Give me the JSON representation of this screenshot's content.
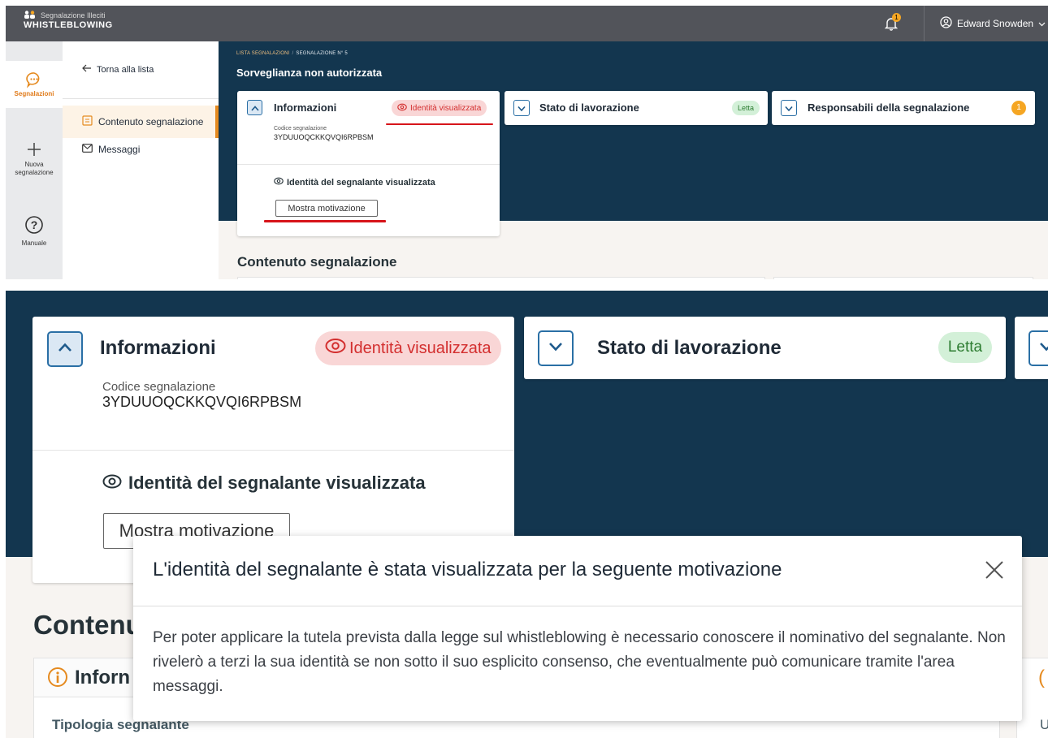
{
  "app": {
    "logo_line1": "Segnalazione Illeciti",
    "logo_line2": "WHISTLEBLOWING",
    "notifications_count": "1",
    "user_name": "Edward Snowden"
  },
  "rail": {
    "segnalazioni": "Segnalazioni",
    "nuova": "Nuova segnalazione",
    "manuale": "Manuale"
  },
  "nav": {
    "back": "Torna alla lista",
    "contenuto": "Contenuto segnalazione",
    "messaggi": "Messaggi"
  },
  "breadcrumb": {
    "list": "LISTA SEGNALAZIONI",
    "current": "SEGNALAZIONE N° 5"
  },
  "report": {
    "title": "Sorveglianza non autorizzata"
  },
  "info_card": {
    "title": "Informazioni",
    "identity_pill": "Identità visualizzata",
    "code_label": "Codice segnalazione",
    "code_value": "3YDUUOQCKKQVQI6RPBSM",
    "identity_status": "Identità del segnalante visualizzata",
    "show_reason_button": "Mostra motivazione"
  },
  "status_card": {
    "title": "Stato di lavorazione",
    "status": "Letta"
  },
  "responsabili_card": {
    "title": "Responsabili della segnalazione",
    "count": "1"
  },
  "section": {
    "contenuto": "Contenuto segnalazione",
    "contenuto_partial": "Contenu",
    "info_partial": "Inforn",
    "tipologia_partial": "Tipologia segnalante",
    "right_partial": "U"
  },
  "modal": {
    "title": "L'identità del segnalante è stata visualizzata per la seguente motivazione",
    "body": "Per poter applicare la tutela prevista dalla legge sul whistleblowing è necessario conoscere il nominativo del segnalante. Non rivelerò a terzi la sua identità se non sotto il suo esplicito consenso, che eventualmente può comunicare tramite l'area messaggi."
  },
  "colors": {
    "hero": "#13364f",
    "accent_orange": "#e58a1f",
    "identity_red": "#d32f2f",
    "status_green": "#2e7d32"
  }
}
